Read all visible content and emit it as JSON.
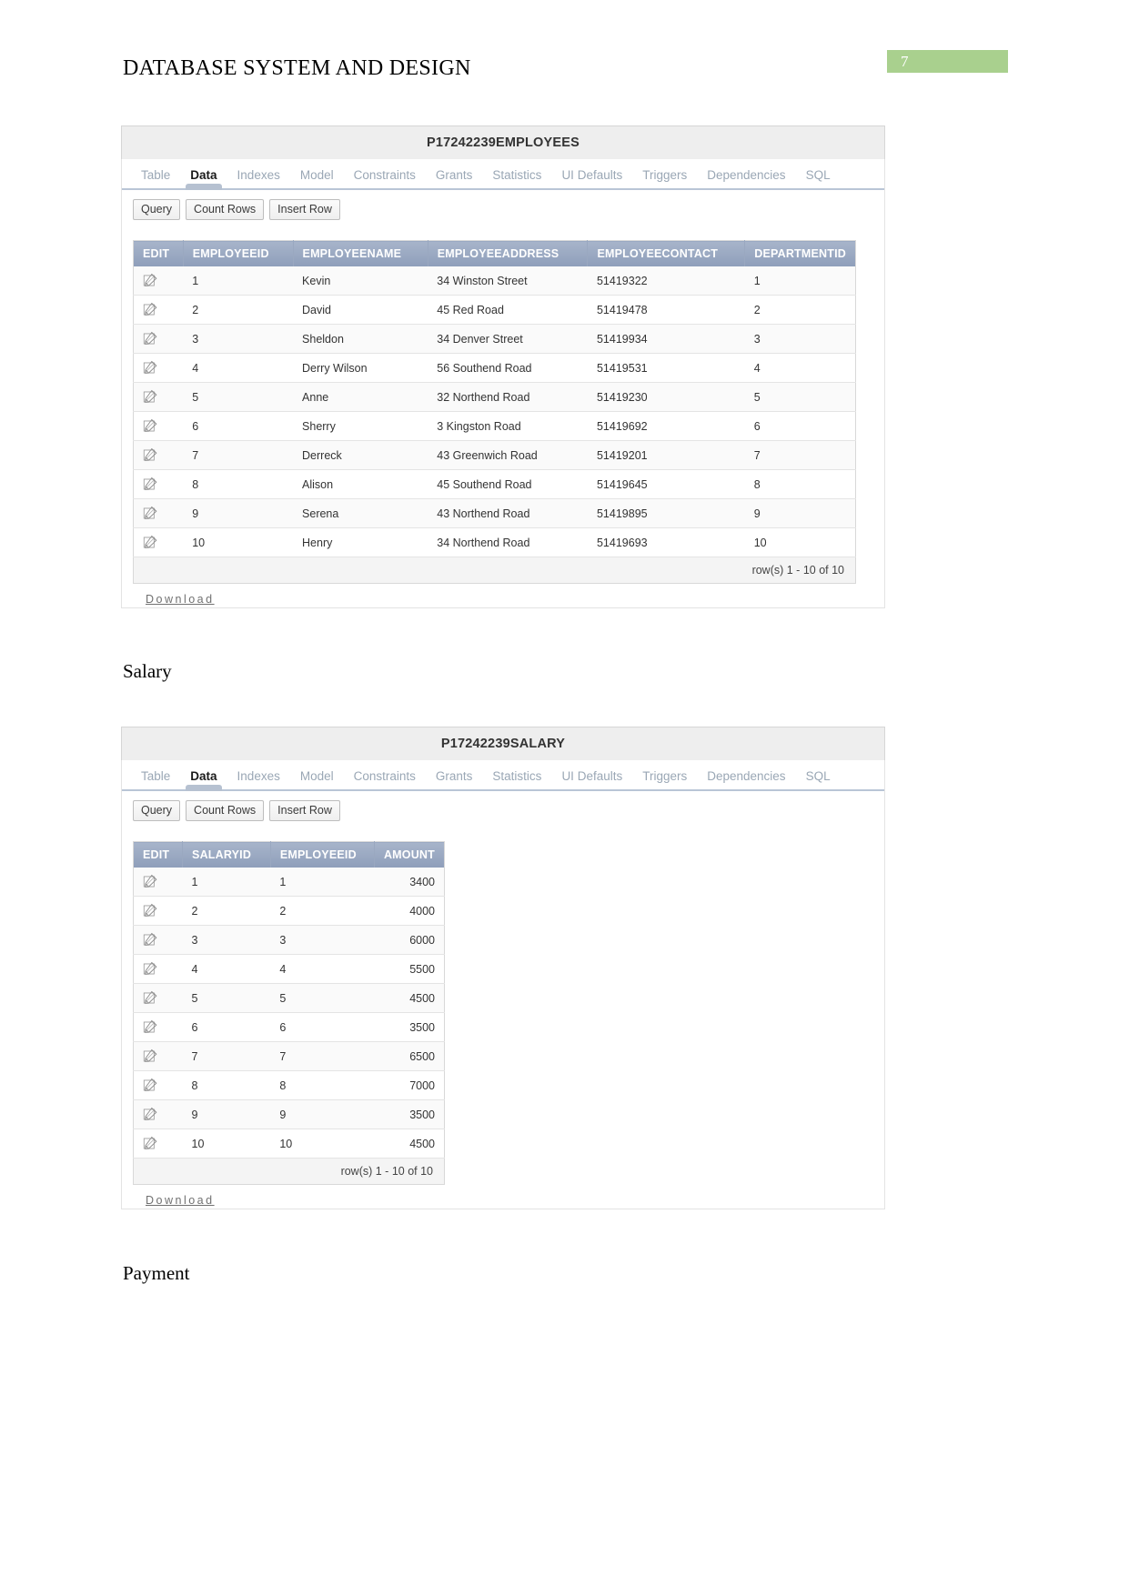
{
  "document": {
    "header_title": "DATABASE SYSTEM AND DESIGN",
    "page_number": "7",
    "page_number_color": "#a9d08e"
  },
  "headings": {
    "salary": "Salary",
    "payment": "Payment"
  },
  "shared": {
    "tabs": [
      "Table",
      "Data",
      "Indexes",
      "Model",
      "Constraints",
      "Grants",
      "Statistics",
      "UI Defaults",
      "Triggers",
      "Dependencies",
      "SQL"
    ],
    "active_tab": "Data",
    "buttons": [
      "Query",
      "Count Rows",
      "Insert Row"
    ],
    "download_label": "Download",
    "edit_icon": "pencil-edit-icon"
  },
  "employees_panel": {
    "title": "P17242239EMPLOYEES",
    "columns": [
      "EDIT",
      "EMPLOYEEID",
      "EMPLOYEENAME",
      "EMPLOYEEADDRESS",
      "EMPLOYEECONTACT",
      "DEPARTMENTID"
    ],
    "rows": [
      {
        "employeeid": "1",
        "employeename": "Kevin",
        "employeeaddress": "34 Winston Street",
        "employeecontact": "51419322",
        "departmentid": "1"
      },
      {
        "employeeid": "2",
        "employeename": "David",
        "employeeaddress": "45 Red Road",
        "employeecontact": "51419478",
        "departmentid": "2"
      },
      {
        "employeeid": "3",
        "employeename": "Sheldon",
        "employeeaddress": "34 Denver Street",
        "employeecontact": "51419934",
        "departmentid": "3"
      },
      {
        "employeeid": "4",
        "employeename": "Derry Wilson",
        "employeeaddress": "56 Southend Road",
        "employeecontact": "51419531",
        "departmentid": "4"
      },
      {
        "employeeid": "5",
        "employeename": "Anne",
        "employeeaddress": "32 Northend Road",
        "employeecontact": "51419230",
        "departmentid": "5"
      },
      {
        "employeeid": "6",
        "employeename": "Sherry",
        "employeeaddress": "3 Kingston Road",
        "employeecontact": "51419692",
        "departmentid": "6"
      },
      {
        "employeeid": "7",
        "employeename": "Derreck",
        "employeeaddress": "43 Greenwich Road",
        "employeecontact": "51419201",
        "departmentid": "7"
      },
      {
        "employeeid": "8",
        "employeename": "Alison",
        "employeeaddress": "45 Southend Road",
        "employeecontact": "51419645",
        "departmentid": "8"
      },
      {
        "employeeid": "9",
        "employeename": "Serena",
        "employeeaddress": "43 Northend Road",
        "employeecontact": "51419895",
        "departmentid": "9"
      },
      {
        "employeeid": "10",
        "employeename": "Henry",
        "employeeaddress": "34 Northend Road",
        "employeecontact": "51419693",
        "departmentid": "10"
      }
    ],
    "rowcount": "row(s) 1 - 10 of 10"
  },
  "salary_panel": {
    "title": "P17242239SALARY",
    "columns": [
      "EDIT",
      "SALARYID",
      "EMPLOYEEID",
      "AMOUNT"
    ],
    "rows": [
      {
        "salaryid": "1",
        "employeeid": "1",
        "amount": "3400"
      },
      {
        "salaryid": "2",
        "employeeid": "2",
        "amount": "4000"
      },
      {
        "salaryid": "3",
        "employeeid": "3",
        "amount": "6000"
      },
      {
        "salaryid": "4",
        "employeeid": "4",
        "amount": "5500"
      },
      {
        "salaryid": "5",
        "employeeid": "5",
        "amount": "4500"
      },
      {
        "salaryid": "6",
        "employeeid": "6",
        "amount": "3500"
      },
      {
        "salaryid": "7",
        "employeeid": "7",
        "amount": "6500"
      },
      {
        "salaryid": "8",
        "employeeid": "8",
        "amount": "7000"
      },
      {
        "salaryid": "9",
        "employeeid": "9",
        "amount": "3500"
      },
      {
        "salaryid": "10",
        "employeeid": "10",
        "amount": "4500"
      }
    ],
    "rowcount": "row(s) 1 - 10 of 10"
  }
}
